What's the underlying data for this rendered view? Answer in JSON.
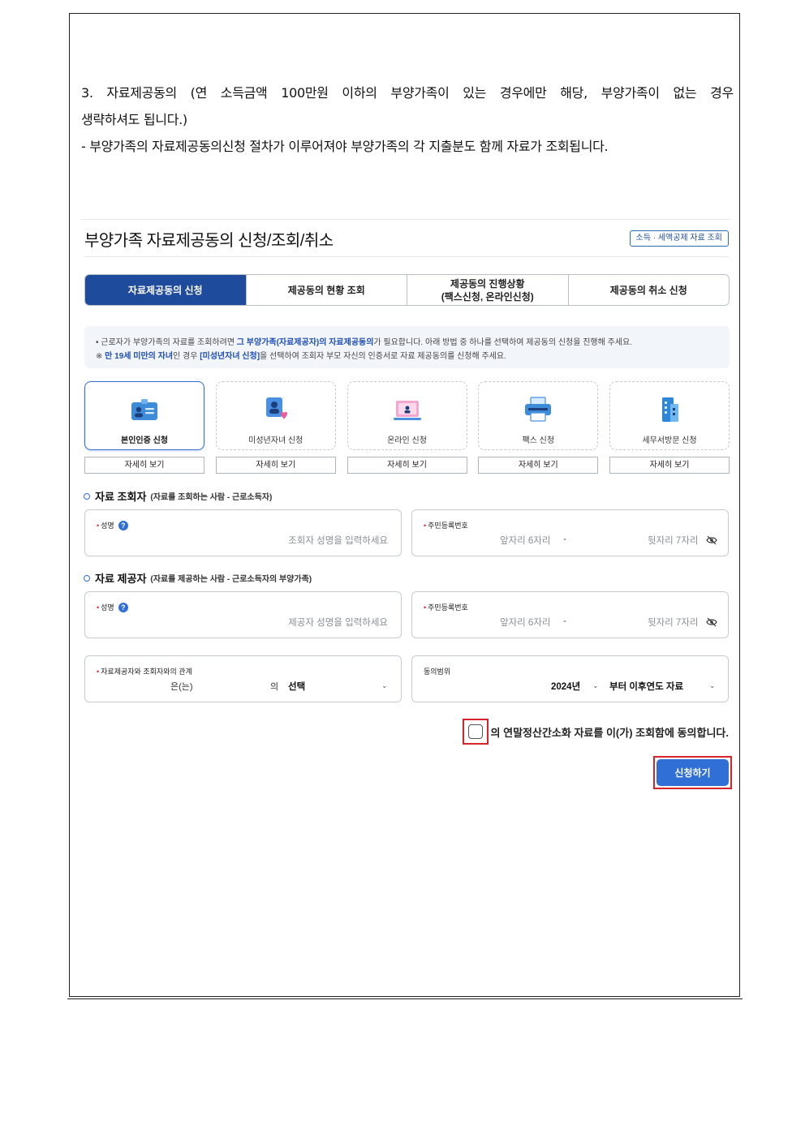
{
  "doc": {
    "line1_words": [
      "3.",
      "자료제공동의",
      "(연",
      "소득금액",
      "100만원",
      "이하의",
      "부양가족이",
      "있는",
      "경우에만",
      "해당,",
      "부양가족이",
      "없는",
      "경우"
    ],
    "line2": "생략하셔도 됩니다.)",
    "line3": "- 부양가족의 자료제공동의신청 절차가 이루어져야 부양가족의 각 지출분도 함께 자료가 조회됩니다."
  },
  "header": {
    "title": "부양가족 자료제공동의 신청/조회/취소",
    "link": "소득 · 세액공제 자료 조회"
  },
  "tabs": [
    {
      "label": "자료제공동의 신청",
      "active": true
    },
    {
      "label": "제공동의 현황 조회",
      "active": false
    },
    {
      "label_line1": "제공동의 진행상황",
      "label_line2": "(팩스신청, 온라인신청)",
      "active": false
    },
    {
      "label": "제공동의 취소 신청",
      "active": false
    }
  ],
  "notice": {
    "l1_a": "근로자가 부양가족의 자료를 조회하려면 ",
    "l1_hl": "그 부양가족(자료제공자)의 자료제공동의",
    "l1_b": "가 필요합니다. 아래 방법 중 하나를 선택하여 제공동의 신청을 진행해 주세요.",
    "l2_mark": "※ ",
    "l2_hl1": "만 19세 미만의 자녀",
    "l2_a": "인 경우 ",
    "l2_hl2": "[미성년자녀 신청]",
    "l2_b": "을 선택하여 조회자 부모 자신의 인증서로 자료 제공동의를 신청해 주세요."
  },
  "methods": [
    {
      "label": "본인인증 신청",
      "icon": "id-card-icon",
      "selected": true,
      "detail": "자세히 보기"
    },
    {
      "label": "미성년자녀 신청",
      "icon": "child-heart-icon",
      "selected": false,
      "detail": "자세히 보기"
    },
    {
      "label": "온라인 신청",
      "icon": "laptop-icon",
      "selected": false,
      "detail": "자세히 보기"
    },
    {
      "label": "팩스 신청",
      "icon": "fax-icon",
      "selected": false,
      "detail": "자세히 보기"
    },
    {
      "label": "세무서방문 신청",
      "icon": "building-icon",
      "selected": false,
      "detail": "자세히 보기"
    }
  ],
  "inquirer": {
    "title": "자료 조회자",
    "subtitle": "(자료를 조회하는 사람 - 근로소득자)",
    "name_label": "성명",
    "name_placeholder": "조회자 성명을 입력하세요",
    "rrn_label": "주민등록번호",
    "rrn_front_placeholder": "앞자리 6자리",
    "rrn_dash": "-",
    "rrn_back_placeholder": "뒷자리 7자리"
  },
  "provider": {
    "title": "자료 제공자",
    "subtitle": "(자료를 제공하는 사람 - 근로소득자의 부양가족)",
    "name_label": "성명",
    "name_placeholder": "제공자 성명을 입력하세요",
    "rrn_label": "주민등록번호",
    "rrn_front_placeholder": "앞자리 6자리",
    "rrn_dash": "-",
    "rrn_back_placeholder": "뒷자리 7자리"
  },
  "relation": {
    "label": "자료제공자와 조회자와의 관계",
    "subject": "은(는)",
    "particle": "의",
    "select_value": "선택"
  },
  "scope": {
    "label": "동의범위",
    "year": "2024년",
    "suffix": "부터 이후연도 자료"
  },
  "consent": {
    "text": "의 연말정산간소화 자료를 이(가) 조회함에 동의합니다."
  },
  "submit": {
    "label": "신청하기"
  },
  "colors": {
    "primary": "#1e4b9c",
    "button": "#2f6fd6",
    "highlight_box": "#d9232b"
  }
}
